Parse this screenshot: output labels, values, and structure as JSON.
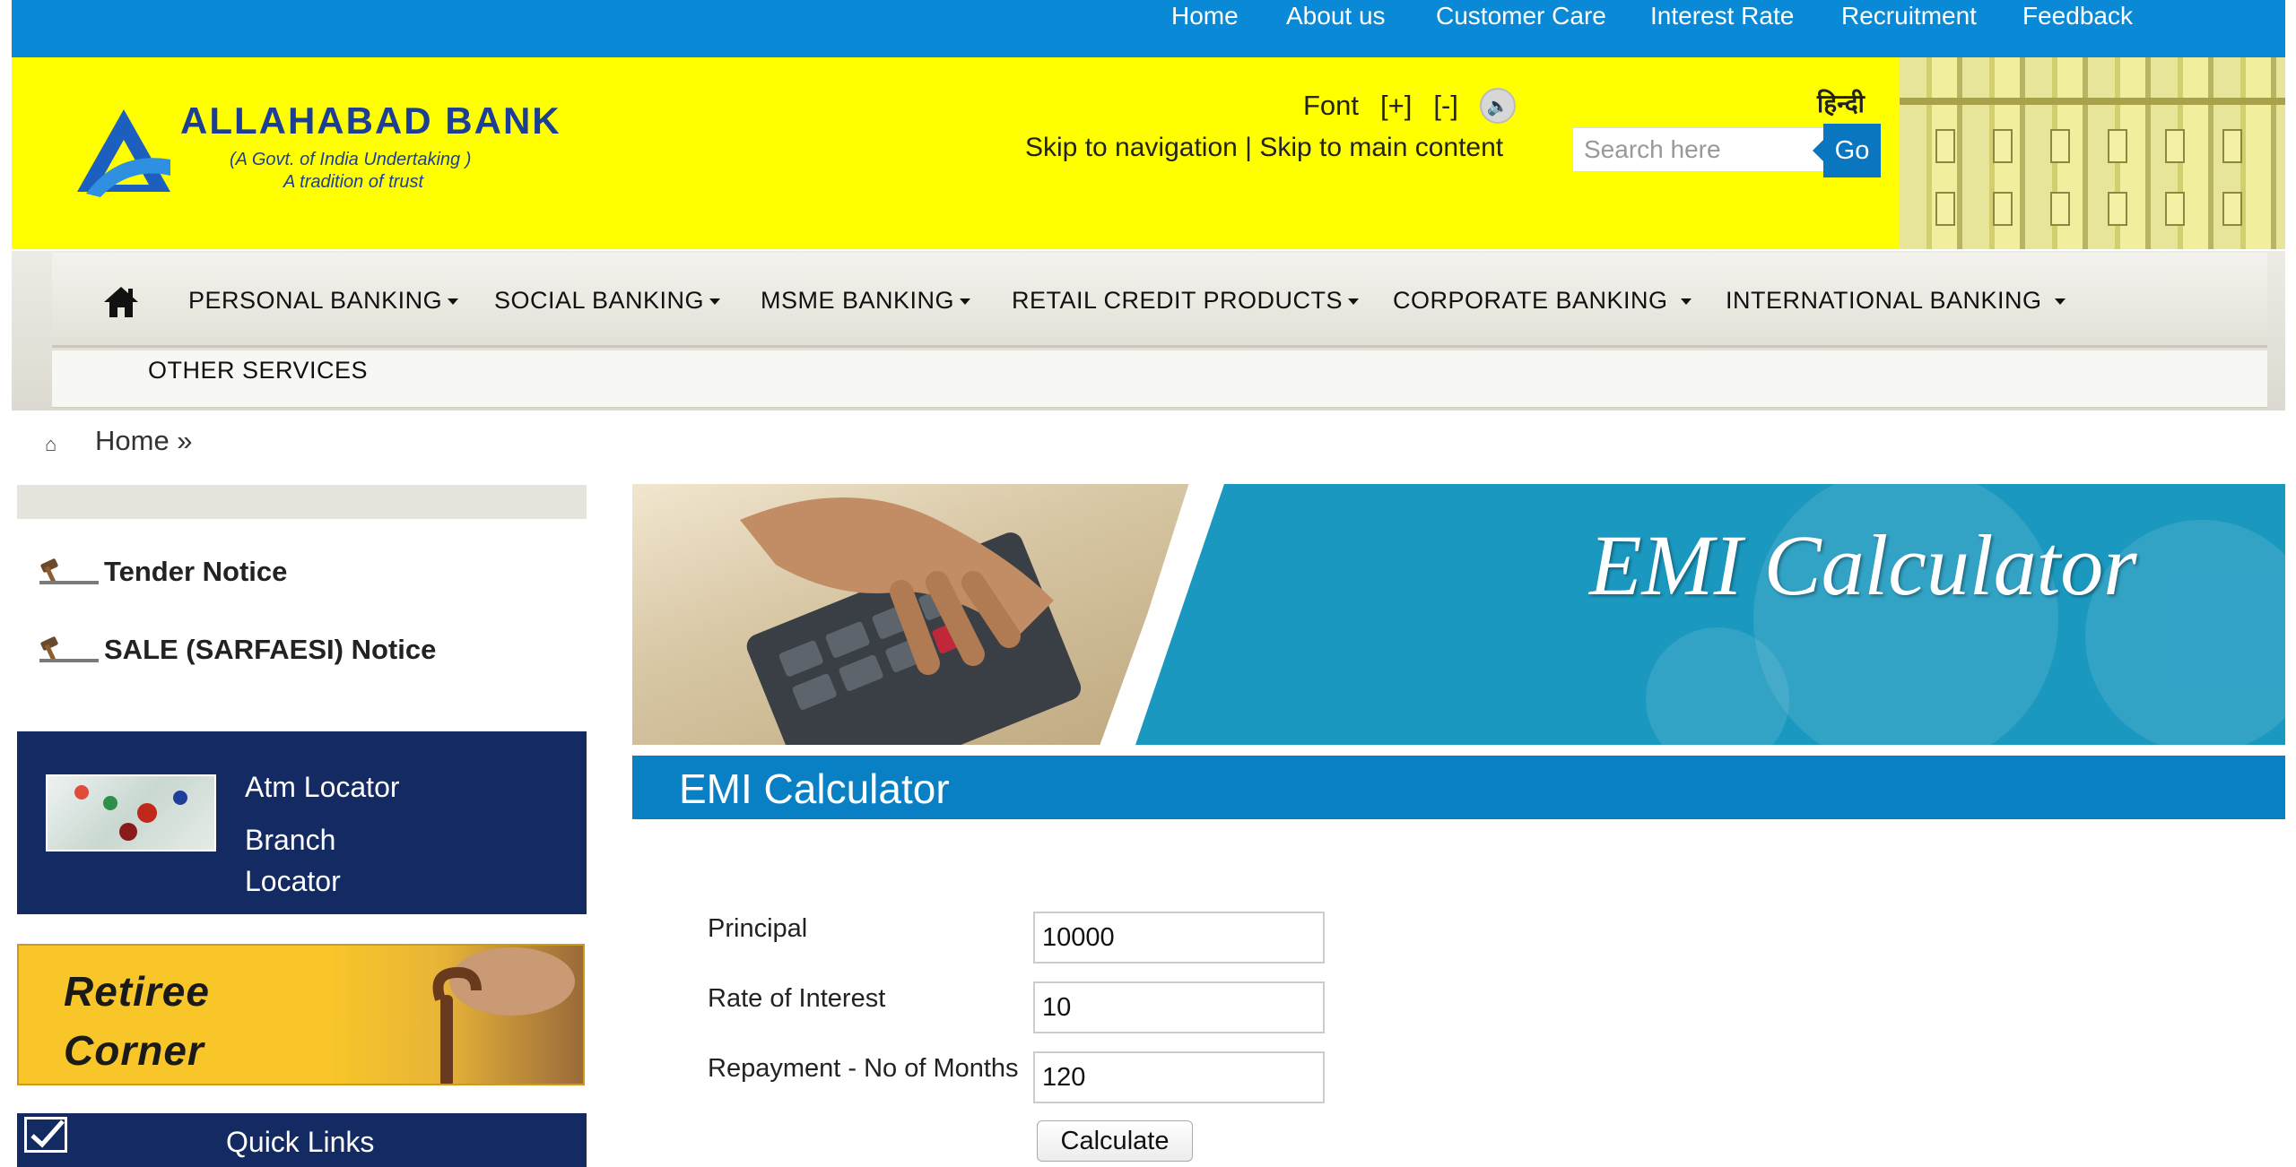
{
  "top_nav": [
    "Home",
    "About us",
    "Customer Care",
    "Interest Rate",
    "Recruitment",
    "Feedback"
  ],
  "header": {
    "bank_name": "ALLAHABAD BANK",
    "tagline_1": "(A Govt. of India Undertaking )",
    "tagline_2": "A tradition of trust",
    "font_label": "Font",
    "font_increase": "[+]",
    "font_decrease": "[-]",
    "skip_nav": "Skip to navigation",
    "skip_separator": "|",
    "skip_main": "Skip to main content",
    "language_link": "हिन्दी",
    "search_placeholder": "Search here",
    "search_button": "Go"
  },
  "main_nav": {
    "items": [
      "PERSONAL BANKING",
      "SOCIAL BANKING",
      "MSME BANKING",
      "RETAIL CREDIT PRODUCTS",
      "CORPORATE BANKING",
      "INTERNATIONAL BANKING"
    ],
    "row2_item": "OTHER SERVICES"
  },
  "breadcrumb": {
    "text": "Home »"
  },
  "sidebar": {
    "notices": [
      "Tender Notice",
      "SALE (SARFAESI) Notice"
    ],
    "atm_locator": "Atm Locator",
    "branch_locator": "Branch\nLocator",
    "retiree_line1": "Retiree",
    "retiree_line2": "Corner",
    "quick_links": "Quick Links"
  },
  "banner": {
    "title": "EMI Calculator"
  },
  "section": {
    "title": "EMI Calculator"
  },
  "form": {
    "principal_label": "Principal",
    "principal_value": "10000",
    "rate_label": "Rate of Interest",
    "rate_value": "10",
    "months_label": "Repayment - No of Months",
    "months_value": "120",
    "calculate_button": "Calculate"
  },
  "colors": {
    "top_bar": "#0a8ad6",
    "header_bg": "#ffff00",
    "brand_blue": "#1c3f95",
    "sidebar_navy": "#142a62",
    "section_blue": "#0a80c4"
  }
}
